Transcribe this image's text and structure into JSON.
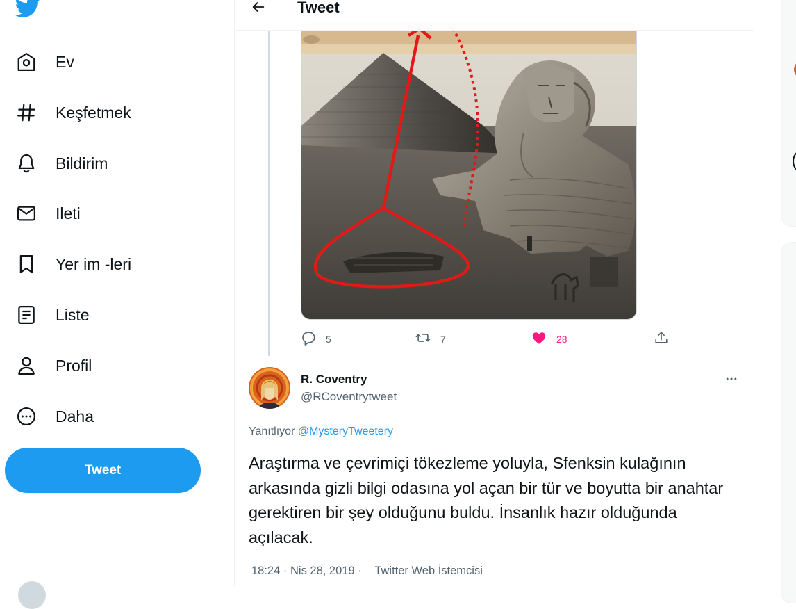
{
  "app": {
    "brand_color": "#1d9bf0"
  },
  "sidebar": {
    "logo_icon": "twitter-bird-icon",
    "items": [
      {
        "label": "Ev",
        "icon": "home-icon"
      },
      {
        "label": "Keşfetmek",
        "icon": "hashtag-icon"
      },
      {
        "label": "Bildirim",
        "icon": "bell-icon"
      },
      {
        "label": "Ileti",
        "icon": "mail-icon"
      },
      {
        "label": "Yer im -leri",
        "icon": "bookmark-icon"
      },
      {
        "label": "Liste",
        "icon": "list-icon"
      },
      {
        "label": "Profil",
        "icon": "profile-icon"
      },
      {
        "label": "Daha",
        "icon": "more-circle-icon"
      }
    ],
    "tweet_button": "Tweet"
  },
  "header": {
    "title": "Tweet",
    "back_icon": "arrow-left-icon"
  },
  "parent_tweet": {
    "actions": {
      "replies": "5",
      "retweets": "7",
      "likes": "28"
    },
    "liked": true,
    "like_color": "#f91880"
  },
  "reply_tweet": {
    "author": {
      "name": "R. Coventry",
      "handle": "@RCoventrytweet"
    },
    "replying_to_label": "Yanıtlıyor",
    "replying_to_handle": "@MysteryTweetery",
    "text": "Araştırma ve çevrimiçi tökezleme yoluyla, Sfenksin kulağının arkasında gizli bilgi odasına yol açan bir tür ve boyutta bir anahtar gerektiren bir şey olduğunu buldu. İnsanlık hazır olduğunda açılacak.",
    "time": "18:24",
    "date": "Nis 28, 2019",
    "client": "Twitter Web İstemcisi"
  }
}
